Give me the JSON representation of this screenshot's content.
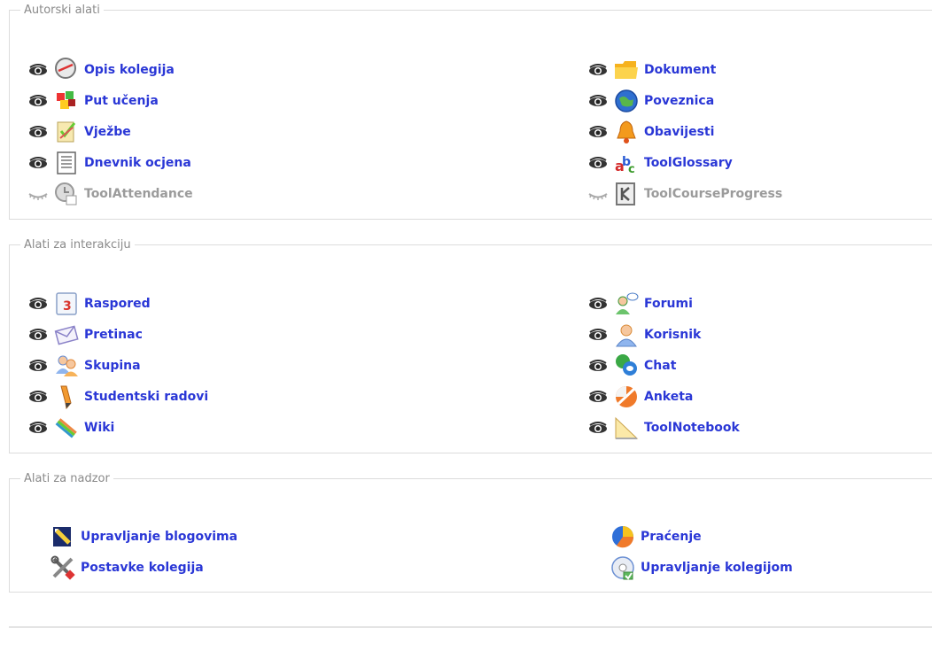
{
  "sections": [
    {
      "legend": "Autorski alati",
      "left": [
        {
          "label": "Opis kolegija",
          "icon": "description-icon",
          "visible": true
        },
        {
          "label": "Put učenja",
          "icon": "learning-path-icon",
          "visible": true
        },
        {
          "label": "Vježbe",
          "icon": "exercises-icon",
          "visible": true
        },
        {
          "label": "Dnevnik ocjena",
          "icon": "gradebook-icon",
          "visible": true
        },
        {
          "label": "ToolAttendance",
          "icon": "attendance-icon",
          "visible": false
        }
      ],
      "right": [
        {
          "label": "Dokument",
          "icon": "folder-icon",
          "visible": true
        },
        {
          "label": "Poveznica",
          "icon": "globe-link-icon",
          "visible": true
        },
        {
          "label": "Obavijesti",
          "icon": "bell-icon",
          "visible": true
        },
        {
          "label": "ToolGlossary",
          "icon": "glossary-icon",
          "visible": true
        },
        {
          "label": "ToolCourseProgress",
          "icon": "course-progress-icon",
          "visible": false
        }
      ]
    },
    {
      "legend": "Alati za interakciju",
      "left": [
        {
          "label": "Raspored",
          "icon": "calendar-icon",
          "visible": true
        },
        {
          "label": "Pretinac",
          "icon": "envelope-icon",
          "visible": true
        },
        {
          "label": "Skupina",
          "icon": "group-icon",
          "visible": true
        },
        {
          "label": "Studentski radovi",
          "icon": "pencil-icon",
          "visible": true
        },
        {
          "label": "Wiki",
          "icon": "wiki-icon",
          "visible": true
        }
      ],
      "right": [
        {
          "label": "Forumi",
          "icon": "forum-icon",
          "visible": true
        },
        {
          "label": "Korisnik",
          "icon": "user-icon",
          "visible": true
        },
        {
          "label": "Chat",
          "icon": "chat-icon",
          "visible": true
        },
        {
          "label": "Anketa",
          "icon": "survey-icon",
          "visible": true
        },
        {
          "label": "ToolNotebook",
          "icon": "notebook-icon",
          "visible": true
        }
      ]
    },
    {
      "legend": "Alati za nadzor",
      "left": [
        {
          "label": "Upravljanje blogovima",
          "icon": "blog-icon"
        },
        {
          "label": "Postavke kolegija",
          "icon": "settings-tools-icon"
        }
      ],
      "right": [
        {
          "label": "Praćenje",
          "icon": "tracking-pie-icon"
        },
        {
          "label": "Upravljanje kolegijom",
          "icon": "course-maintenance-icon"
        }
      ]
    }
  ],
  "colors": {
    "link": "#2a37d6",
    "inactive": "#9b9b9b",
    "legend": "#8a8a8a",
    "border": "#dcdcdc"
  }
}
